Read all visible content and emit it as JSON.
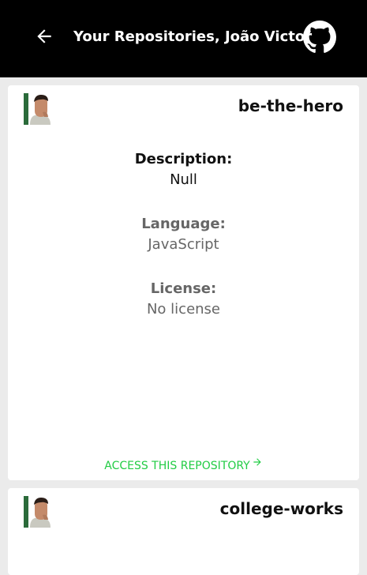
{
  "header": {
    "title": "Your Repositories, João Victor",
    "back_icon": "arrow-left-icon",
    "github_icon": "github-icon"
  },
  "colors": {
    "header_bg": "#000000",
    "page_bg": "#ebebeb",
    "card_bg": "#ffffff",
    "accent": "#22cc44"
  },
  "repositories": [
    {
      "name": "be-the-hero",
      "description_label": "Description:",
      "description": "Null",
      "language_label": "Language:",
      "language": "JavaScript",
      "license_label": "License:",
      "license": "No license",
      "access_label": "ACCESS THIS REPOSITORY",
      "access_icon": "arrow-right-icon"
    },
    {
      "name": "college-works"
    }
  ]
}
